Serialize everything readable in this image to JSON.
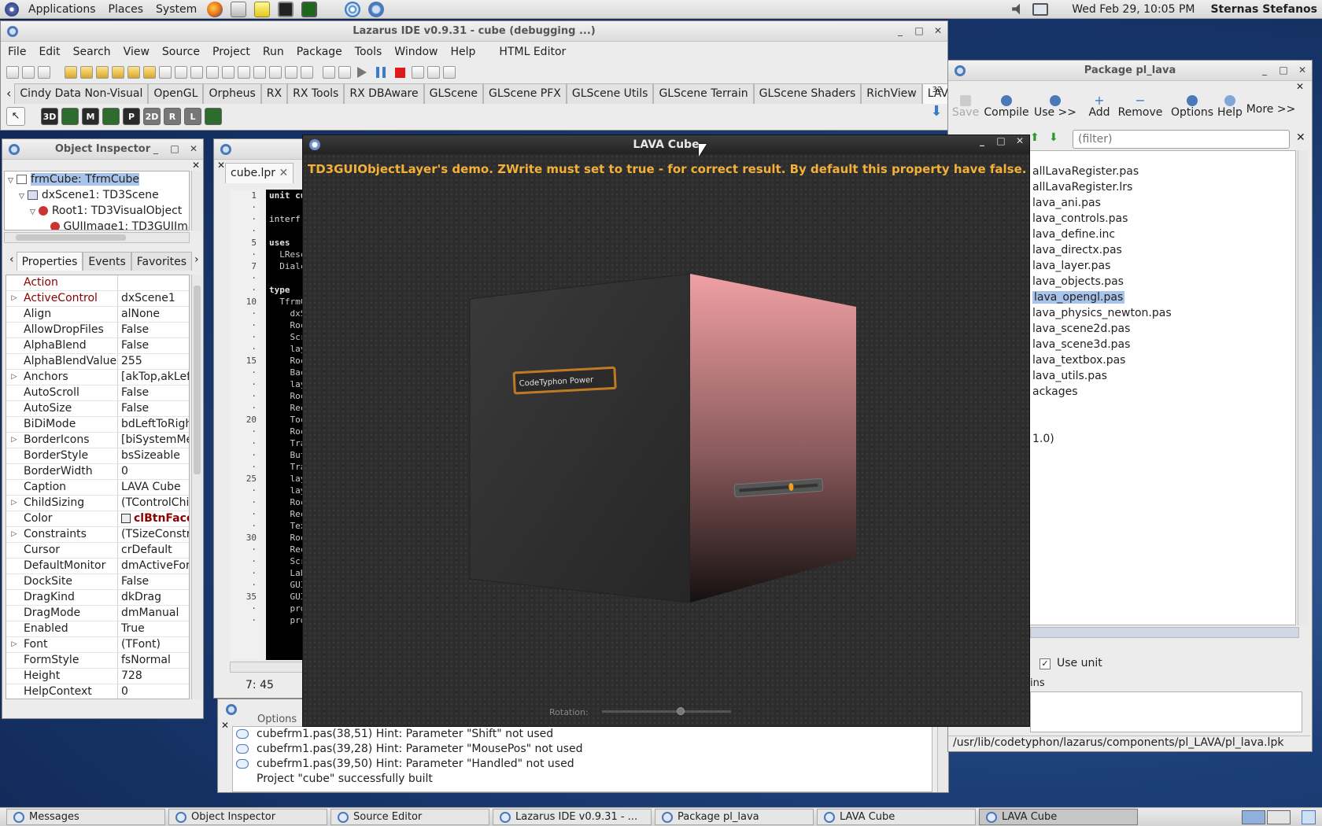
{
  "top_panel": {
    "menus": [
      "Applications",
      "Places",
      "System"
    ],
    "clock": "Wed Feb 29, 10:05 PM",
    "user": "Sternas Stefanos"
  },
  "ide": {
    "title": "Lazarus IDE v0.9.31 - cube (debugging ...)",
    "menu": [
      "File",
      "Edit",
      "Search",
      "View",
      "Source",
      "Project",
      "Run",
      "Package",
      "Tools",
      "Window",
      "Help",
      "HTML Editor"
    ],
    "tabs": [
      "Cindy Data Non-Visual",
      "OpenGL",
      "Orpheus",
      "RX",
      "RX Tools",
      "RX DBAware",
      "GLScene",
      "GLScene PFX",
      "GLScene Utils",
      "GLScene Terrain",
      "GLScene Shaders",
      "RichView",
      "LAVA"
    ],
    "selected_tab": "LAVA",
    "tab_count": "32",
    "component_icons": [
      "3D",
      "M",
      "P",
      "2D",
      "R",
      "L"
    ]
  },
  "object_inspector": {
    "title": "Object Inspector",
    "tree": [
      "frmCube: TfrmCube",
      "dxScene1: TD3Scene",
      "Root1: TD3VisualObject",
      "GUIImage1: TD3GUIImage"
    ],
    "tabs": [
      "Properties",
      "Events",
      "Favorites"
    ],
    "properties": [
      {
        "name": "Action",
        "value": ""
      },
      {
        "name": "ActiveControl",
        "value": "dxScene1"
      },
      {
        "name": "Align",
        "value": "alNone"
      },
      {
        "name": "AllowDropFiles",
        "value": "False"
      },
      {
        "name": "AlphaBlend",
        "value": "False"
      },
      {
        "name": "AlphaBlendValue",
        "value": "255"
      },
      {
        "name": "Anchors",
        "value": "[akTop,akLeft]"
      },
      {
        "name": "AutoScroll",
        "value": "False"
      },
      {
        "name": "AutoSize",
        "value": "False"
      },
      {
        "name": "BiDiMode",
        "value": "bdLeftToRight"
      },
      {
        "name": "BorderIcons",
        "value": "[biSystemMenu]"
      },
      {
        "name": "BorderStyle",
        "value": "bsSizeable"
      },
      {
        "name": "BorderWidth",
        "value": "0"
      },
      {
        "name": "Caption",
        "value": "LAVA Cube"
      },
      {
        "name": "ChildSizing",
        "value": "(TControlChildSizing)"
      },
      {
        "name": "Color",
        "value": "clBtnFace"
      },
      {
        "name": "Constraints",
        "value": "(TSizeConstraints)"
      },
      {
        "name": "Cursor",
        "value": "crDefault"
      },
      {
        "name": "DefaultMonitor",
        "value": "dmActiveForm"
      },
      {
        "name": "DockSite",
        "value": "False"
      },
      {
        "name": "DragKind",
        "value": "dkDrag"
      },
      {
        "name": "DragMode",
        "value": "dmManual"
      },
      {
        "name": "Enabled",
        "value": "True"
      },
      {
        "name": "Font",
        "value": "(TFont)"
      },
      {
        "name": "FormStyle",
        "value": "fsNormal"
      },
      {
        "name": "Height",
        "value": "728"
      },
      {
        "name": "HelpContext",
        "value": "0"
      }
    ]
  },
  "editor": {
    "tab": "cube.lpr",
    "line_numbers": [
      "1",
      "",
      "",
      "",
      "5",
      "",
      "7",
      "",
      "",
      "10",
      "",
      "",
      "",
      "",
      "15",
      "",
      "",
      "",
      "",
      "20",
      "",
      "",
      "",
      "",
      "25",
      "",
      "",
      "",
      "",
      "30",
      "",
      "",
      "",
      "",
      "35",
      "",
      ""
    ],
    "code": [
      "unit cu",
      "",
      "interf",
      "",
      "uses",
      "  LResc",
      "  Dialc",
      "",
      "type",
      "  TfrmC",
      "    dxS",
      "    Roc",
      "    Scr",
      "    lay",
      "    Roc",
      "    Bac",
      "    lay",
      "    Roc",
      "    Rec",
      "    Toc",
      "    Roc",
      "    Tra",
      "    But",
      "    Tra",
      "    lay",
      "    lay",
      "    Roc",
      "    Rec",
      "    Tex",
      "    Roc",
      "    Rec",
      "    Scr",
      "    Lab",
      "    GUI",
      "    GUI",
      "    pro",
      "    pro"
    ],
    "cursor": "7: 45"
  },
  "lava": {
    "title": "LAVA Cube",
    "banner": "TD3GUIObjectLayer's demo. ZWrite must set to true - for correct result. By default this property have false.",
    "label_text": "CodeTyphon Power",
    "rotation_label": "Rotation:",
    "rotation_value": 0.62
  },
  "messages": {
    "options_label": "Options",
    "lines": [
      "cubefrm1.pas(38,51) Hint: Parameter \"Shift\" not used",
      "cubefrm1.pas(39,28) Hint: Parameter \"MousePos\" not used",
      "cubefrm1.pas(39,50) Hint: Parameter \"Handled\" not used",
      "Project \"cube\" successfully built"
    ]
  },
  "package": {
    "title": "Package pl_lava",
    "buttons": [
      "Save",
      "Compile",
      "Use >>",
      "Add",
      "Remove",
      "Options",
      "Help",
      "More >>"
    ],
    "filter_placeholder": "(filter)",
    "files": [
      "allLavaRegister.pas",
      "allLavaRegister.lrs",
      "lava_ani.pas",
      "lava_controls.pas",
      "lava_define.inc",
      "lava_directx.pas",
      "lava_layer.pas",
      "lava_objects.pas",
      "lava_opengl.pas",
      "lava_physics_newton.pas",
      "lava_scene2d.pas",
      "lava_scene3d.pas",
      "lava_textbox.pas",
      "lava_utils.pas",
      "ackages",
      "",
      "",
      "1.0)"
    ],
    "selected_file": "lava_opengl.pas",
    "use_unit_label": "Use unit",
    "group_label": "ins",
    "path": "/usr/lib/codetyphon/lazarus/components/pl_LAVA/pl_lava.lpk"
  },
  "taskbar": [
    "Messages",
    "Object Inspector",
    "Source Editor",
    "Lazarus IDE v0.9.31 - ...",
    "Package pl_lava",
    "LAVA Cube",
    "LAVA Cube"
  ],
  "colors": {
    "selection": "#a9c4eb",
    "banner": "#f3b13a",
    "prop_name_red": "#8b0000"
  }
}
